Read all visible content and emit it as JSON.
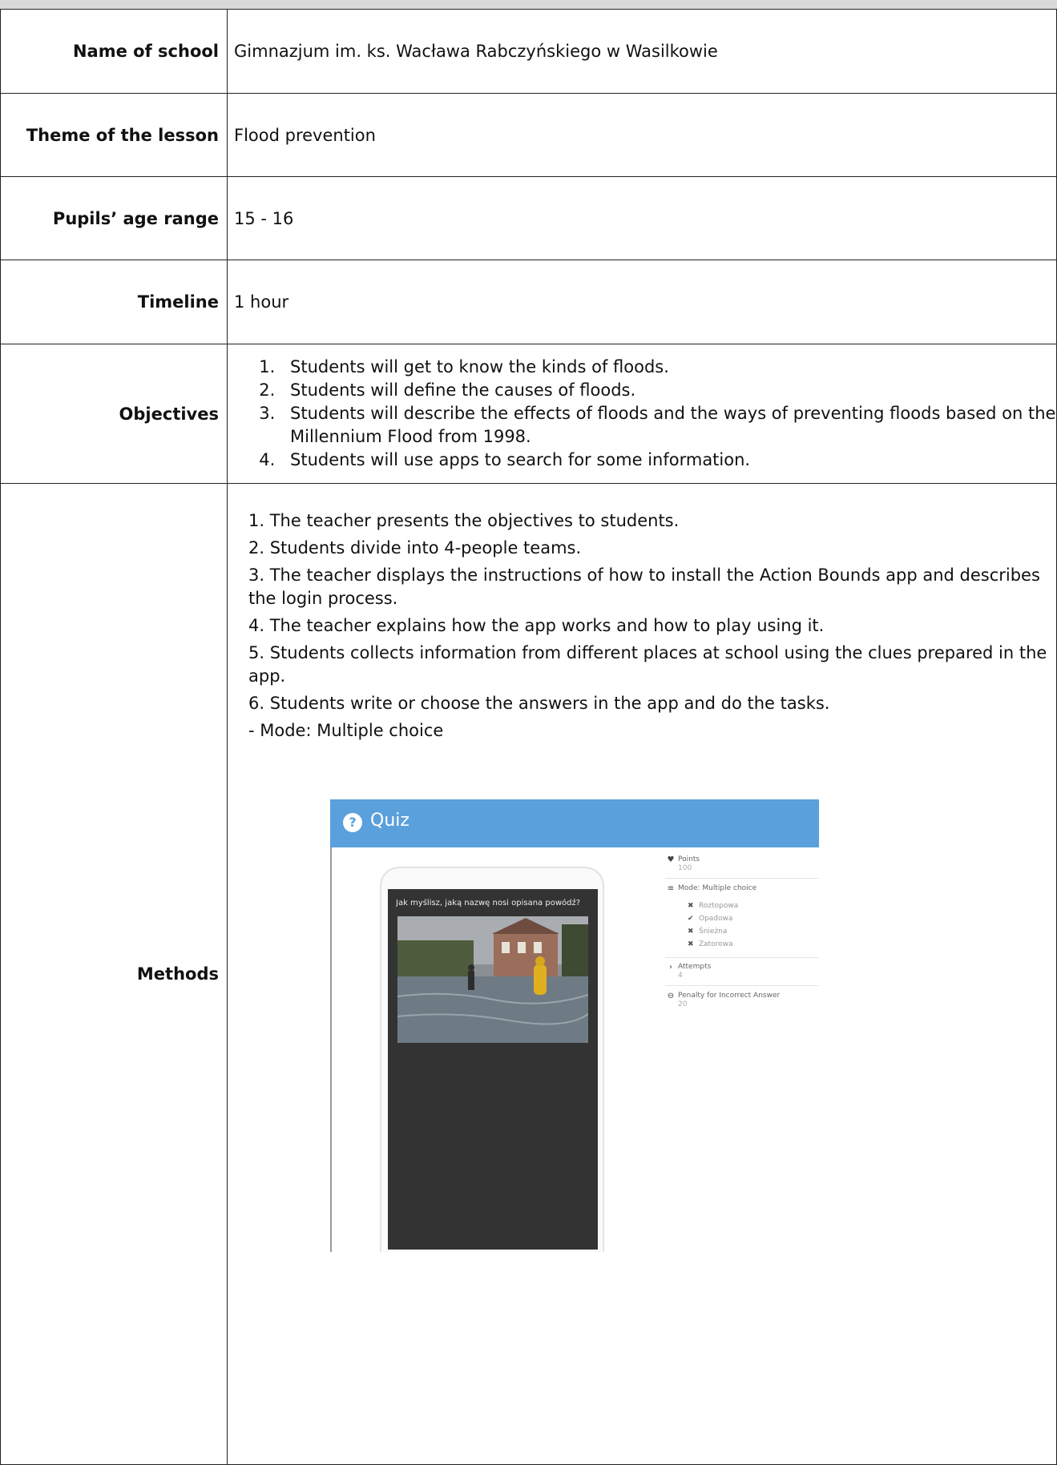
{
  "rows": {
    "school": {
      "label": "Name of school",
      "value": "Gimnazjum im. ks. Wacława Rabczyńskiego w Wasilkowie"
    },
    "theme": {
      "label": "Theme of the lesson",
      "value": "Flood prevention"
    },
    "age": {
      "label": "Pupils’ age range",
      "value": "15 - 16"
    },
    "timeline": {
      "label": "Timeline",
      "value": "1 hour"
    },
    "objectives": {
      "label": "Objectives",
      "items": [
        "Students will get to know the kinds of floods.",
        "Students will define the causes of floods.",
        "Students will describe the effects of floods and the ways of preventing floods based on the Millennium Flood from 1998.",
        "Students will use apps to search for some information."
      ]
    },
    "methods": {
      "label": "Methods",
      "steps": [
        "1. The teacher presents the objectives to students.",
        "2. Students divide into 4-people teams.",
        "3. The teacher displays the instructions of how to install the Action Bounds app and describes the login process.",
        "4. The teacher explains how the app works and how to play using it.",
        "5. Students collects information from different places at school using the clues prepared in the app.",
        "6. Students write or choose the answers in the app and do the tasks."
      ],
      "mode_line": "-   Mode: Multiple choice"
    }
  },
  "screenshot": {
    "title": "Quiz",
    "question": "Jak myślisz, jaką nazwę nosi opisana powódź?",
    "points_label": "Points",
    "points_value": "100",
    "mode_label": "Mode: Multiple choice",
    "options": [
      {
        "mark": "✖",
        "text": "Roztopowa"
      },
      {
        "mark": "✔",
        "text": "Opadowa"
      },
      {
        "mark": "✖",
        "text": "Śnieżna"
      },
      {
        "mark": "✖",
        "text": "Zatorowa"
      }
    ],
    "attempts_label": "Attempts",
    "attempts_value": "4",
    "penalty_label": "Penalty for Incorrect Answer",
    "penalty_value": "20",
    "colors": {
      "header": "#5aa0dc",
      "phone": "#333333"
    }
  }
}
